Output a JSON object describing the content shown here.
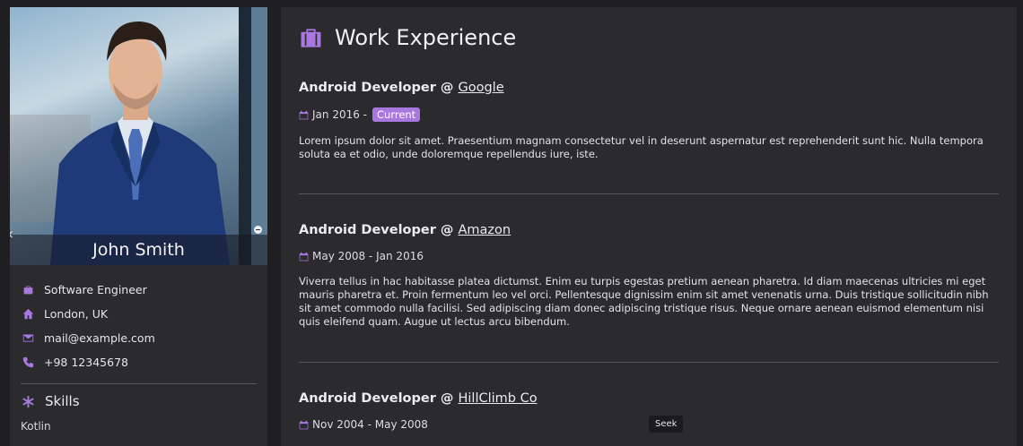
{
  "profile": {
    "name": "John Smith",
    "info": [
      {
        "icon": "briefcase-icon",
        "text": "Software Engineer"
      },
      {
        "icon": "home-icon",
        "text": "London, UK"
      },
      {
        "icon": "mail-icon",
        "text": "mail@example.com"
      },
      {
        "icon": "phone-icon",
        "text": "+98 12345678"
      }
    ],
    "skills_title": "Skills",
    "skills": [
      "Kotlin"
    ]
  },
  "experience": {
    "title": "Work Experience",
    "jobs": [
      {
        "role": "Android Developer @ ",
        "company": "Google",
        "date": "Jan 2016 -",
        "badge": "Current",
        "description": "Lorem ipsum dolor sit amet. Praesentium magnam consectetur vel in deserunt aspernatur est reprehenderit sunt hic. Nulla tempora soluta ea et odio, unde doloremque repellendus iure, iste."
      },
      {
        "role": "Android Developer @ ",
        "company": "Amazon",
        "date": "May 2008 - Jan 2016",
        "description": "Viverra tellus in hac habitasse platea dictumst. Enim eu turpis egestas pretium aenean pharetra. Id diam maecenas ultricies mi eget mauris pharetra et. Proin fermentum leo vel orci. Pellentesque dignissim enim sit amet venenatis urna. Duis tristique sollicitudin nibh sit amet commodo nulla facilisi. Sed adipiscing diam donec adipiscing tristique risus. Neque ornare aenean euismod elementum nisi quis eleifend quam. Augue ut lectus arcu bibendum."
      },
      {
        "role": "Android Developer @ ",
        "company": "HillClimb Co",
        "date": "Nov 2004 - May 2008"
      }
    ]
  },
  "tooltip": {
    "seek": "Seek"
  },
  "colors": {
    "accent": "#a977e0",
    "card": "#2b2b2e",
    "background": "#1f1f21"
  }
}
